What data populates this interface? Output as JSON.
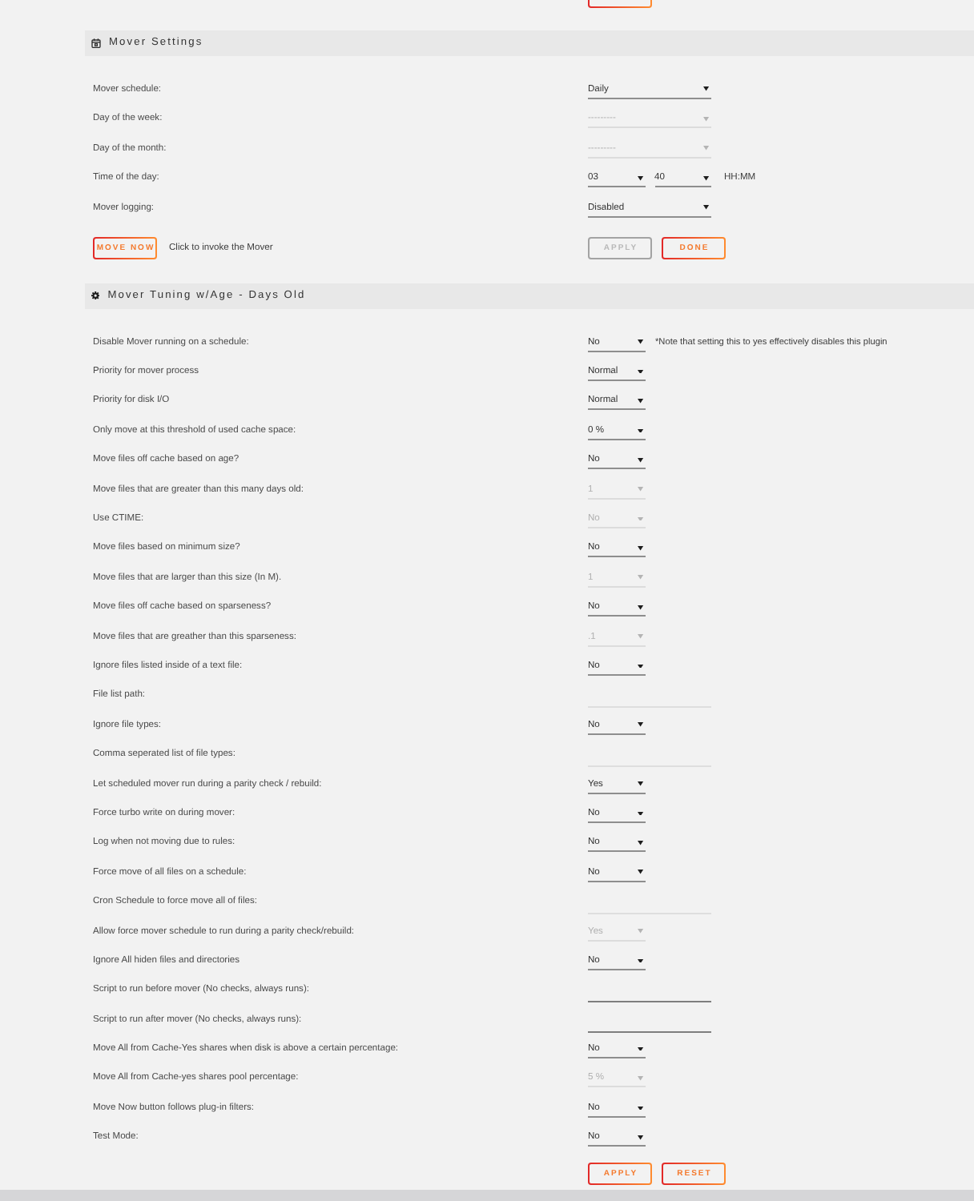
{
  "mover_settings": {
    "title": "Mover Settings",
    "rows": [
      {
        "kind": "select",
        "label": "Mover schedule:",
        "value": "Daily",
        "disabled": false
      },
      {
        "kind": "select",
        "label": "Day of the week:",
        "value": "---------",
        "disabled": true
      },
      {
        "kind": "select",
        "label": "Day of the month:",
        "value": "---------",
        "disabled": true
      },
      {
        "kind": "time",
        "label": "Time of the day:",
        "hour": "03",
        "minute": "40",
        "format": "HH:MM"
      },
      {
        "kind": "select",
        "label": "Mover logging:",
        "value": "Disabled",
        "disabled": false
      }
    ],
    "move_now": {
      "label": "MOVE NOW",
      "hint": "Click to invoke the Mover"
    },
    "buttons": [
      {
        "label": "APPLY",
        "disabled": true
      },
      {
        "label": "DONE",
        "disabled": false
      }
    ]
  },
  "mover_tuning": {
    "title": "Mover Tuning w/Age - Days Old",
    "rows": [
      {
        "kind": "select",
        "label": "Disable Mover running on a schedule:",
        "value": "No",
        "disabled": false,
        "note": "*Note that setting this to yes effectively disables this plugin"
      },
      {
        "kind": "select",
        "label": "Priority for mover process",
        "value": "Normal",
        "disabled": false
      },
      {
        "kind": "select",
        "label": "Priority for disk I/O",
        "value": "Normal",
        "disabled": false
      },
      {
        "kind": "select",
        "label": "Only move at this threshold of used cache space:",
        "value": "0 %",
        "disabled": false
      },
      {
        "kind": "select",
        "label": "Move files off cache based on age?",
        "value": "No",
        "disabled": false
      },
      {
        "kind": "select",
        "label": "Move files that are greater than this many days old:",
        "value": "1",
        "disabled": true
      },
      {
        "kind": "select",
        "label": "Use CTIME:",
        "value": "No",
        "disabled": true
      },
      {
        "kind": "select",
        "label": "Move files based on minimum size?",
        "value": "No",
        "disabled": false
      },
      {
        "kind": "select",
        "label": "Move files that are larger than this size (In M).",
        "value": "1",
        "disabled": true
      },
      {
        "kind": "select",
        "label": "Move files off cache based on sparseness?",
        "value": "No",
        "disabled": false
      },
      {
        "kind": "select",
        "label": "Move files that are greather than this sparseness:",
        "value": ".1",
        "disabled": true
      },
      {
        "kind": "select",
        "label": "Ignore files listed inside of a text file:",
        "value": "No",
        "disabled": false
      },
      {
        "kind": "text",
        "label": "File list path:",
        "disabled": true
      },
      {
        "kind": "select",
        "label": "Ignore file types:",
        "value": "No",
        "disabled": false
      },
      {
        "kind": "text",
        "label": "Comma seperated list of file types:",
        "disabled": true
      },
      {
        "kind": "select",
        "label": "Let scheduled mover run during a parity check / rebuild:",
        "value": "Yes",
        "disabled": false
      },
      {
        "kind": "select",
        "label": "Force turbo write on during mover:",
        "value": "No",
        "disabled": false
      },
      {
        "kind": "select",
        "label": "Log when not moving due to rules:",
        "value": "No",
        "disabled": false
      },
      {
        "kind": "select",
        "label": "Force move of all files on a schedule:",
        "value": "No",
        "disabled": false
      },
      {
        "kind": "text",
        "label": "Cron Schedule to force move all of files:",
        "disabled": true
      },
      {
        "kind": "select",
        "label": "Allow force mover schedule to run during a parity check/rebuild:",
        "value": "Yes",
        "disabled": true
      },
      {
        "kind": "select",
        "label": "Ignore All hiden files and directories",
        "value": "No",
        "disabled": false
      },
      {
        "kind": "text",
        "label": "Script to run before mover (No checks, always runs):",
        "disabled": false
      },
      {
        "kind": "text",
        "label": "Script to run after mover (No checks, always runs):",
        "disabled": false
      },
      {
        "kind": "select",
        "label": "Move All from Cache-Yes shares when disk is above a certain percentage:",
        "value": "No",
        "disabled": false
      },
      {
        "kind": "select",
        "label": "Move All from Cache-yes shares pool percentage:",
        "value": "5 %",
        "disabled": true
      },
      {
        "kind": "select",
        "label": "Move Now button follows plug-in filters:",
        "value": "No",
        "disabled": false
      },
      {
        "kind": "select",
        "label": "Test Mode:",
        "value": "No",
        "disabled": false
      }
    ],
    "buttons": [
      {
        "label": "APPLY",
        "disabled": false
      },
      {
        "label": "RESET",
        "disabled": false
      }
    ]
  }
}
